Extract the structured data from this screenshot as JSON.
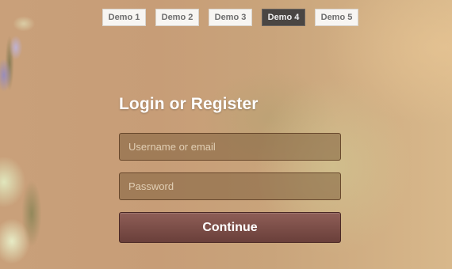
{
  "demo_nav": {
    "items": [
      "Demo 1",
      "Demo 2",
      "Demo 3",
      "Demo 4",
      "Demo 5"
    ],
    "active": "Demo 4"
  },
  "form": {
    "title": "Login or Register",
    "username_placeholder": "Username or email",
    "password_placeholder": "Password",
    "submit_label": "Continue"
  },
  "colors": {
    "active_tab": "#4a4643",
    "submit_button": "#7a4d47",
    "field_bg": "#80603e"
  }
}
